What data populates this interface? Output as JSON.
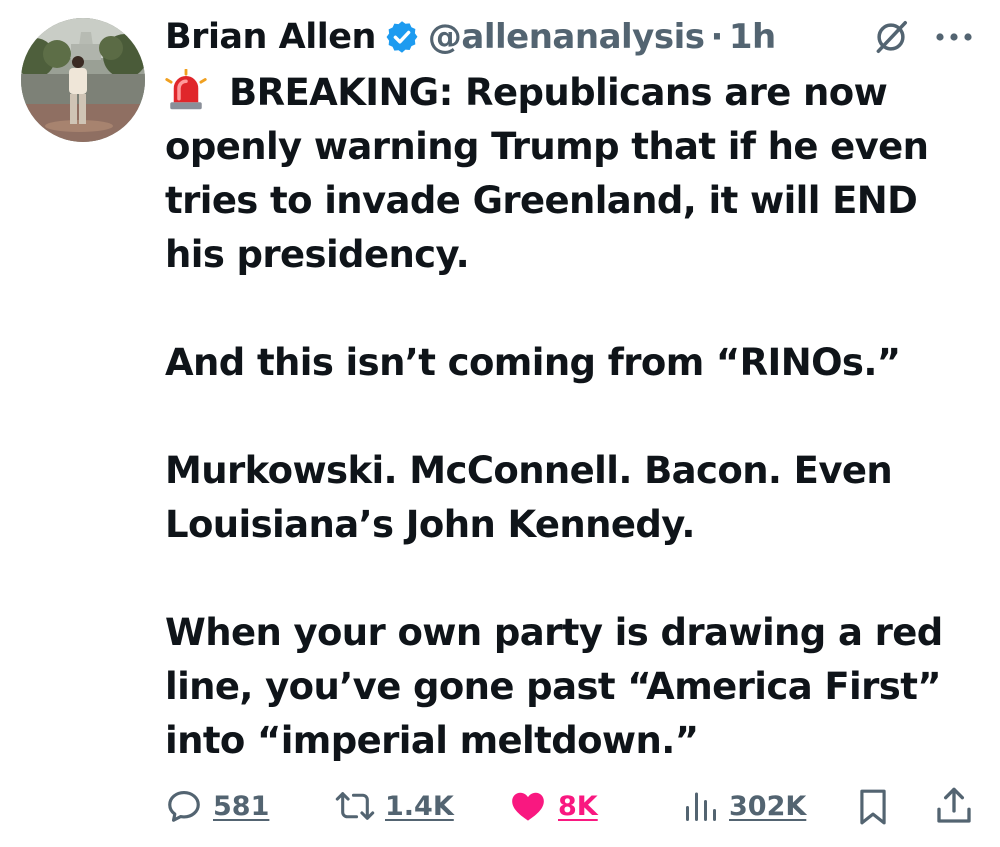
{
  "author": {
    "name": "Brian Allen",
    "handle": "@allenanalysis",
    "separator": "·",
    "time": "1h",
    "verified": true
  },
  "post": {
    "paragraphs": [
      "BREAKING: Republicans are now openly warning Trump that if he even tries to invade Greenland, it will END his presidency.",
      "And this isn’t coming from “RINOs.”",
      "Murkowski. McConnell. Bacon. Even Louisiana’s John Kennedy.",
      "When your own party is drawing a red line, you’ve gone past “America First” into “imperial meltdown.”"
    ],
    "leading_emoji": "siren-emoji"
  },
  "actions": {
    "replies": "581",
    "reposts": "1.4K",
    "likes": "8K",
    "views": "302K"
  },
  "colors": {
    "text": "#0f1419",
    "secondary": "#536471",
    "verified_blue": "#1d9bf0",
    "like_pink": "#f91880"
  },
  "icons": [
    "verified-badge-icon",
    "grok-icon",
    "more-icon",
    "reply-icon",
    "retweet-icon",
    "heart-icon",
    "views-icon",
    "bookmark-icon",
    "share-icon"
  ]
}
